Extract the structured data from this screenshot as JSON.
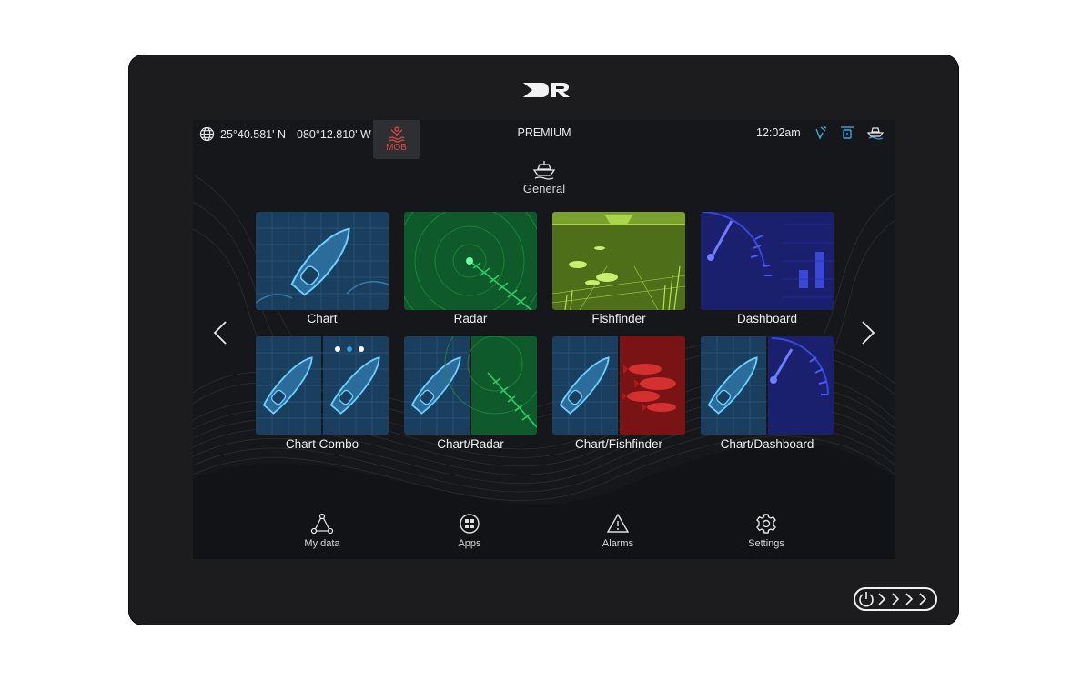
{
  "header": {
    "coord_lat": "25°40.581' N",
    "coord_lon": "080°12.810' W",
    "mob_label": "MOB",
    "mode": "PREMIUM",
    "time": "12:02am"
  },
  "group": {
    "label": "General"
  },
  "apps": [
    {
      "label": "Chart"
    },
    {
      "label": "Radar"
    },
    {
      "label": "Fishfinder"
    },
    {
      "label": "Dashboard"
    },
    {
      "label": "Chart Combo"
    },
    {
      "label": "Chart/Radar"
    },
    {
      "label": "Chart/Fishfinder"
    },
    {
      "label": "Chart/Dashboard"
    }
  ],
  "pagination": {
    "pages": 3,
    "current": 2
  },
  "nav": {
    "items": [
      {
        "label": "My data"
      },
      {
        "label": "Apps"
      },
      {
        "label": "Alarms"
      },
      {
        "label": "Settings"
      }
    ]
  },
  "icons": {
    "globe": "globe-icon",
    "mob": "man-overboard-icon",
    "gps": "gps-satellite-icon",
    "sonar": "sonar-icon",
    "boat": "boat-status-icon",
    "group": "boat-icon",
    "prev": "chevron-left-icon",
    "next": "chevron-right-icon",
    "mydata": "my-data-icon",
    "apps": "apps-grid-icon",
    "alarms": "alarm-triangle-icon",
    "settings": "gear-icon",
    "power": "power-icon"
  },
  "colors": {
    "bezel": "#1c1c1e",
    "screen": "#16171a",
    "accent": "#2f9cd9",
    "mob": "#e0463d",
    "chart": "#1a3e5e",
    "radar": "#1f8a3e",
    "fish": "#7aa12c",
    "dash": "#2a31a8",
    "fishfinder_red": "#a51d1d"
  }
}
